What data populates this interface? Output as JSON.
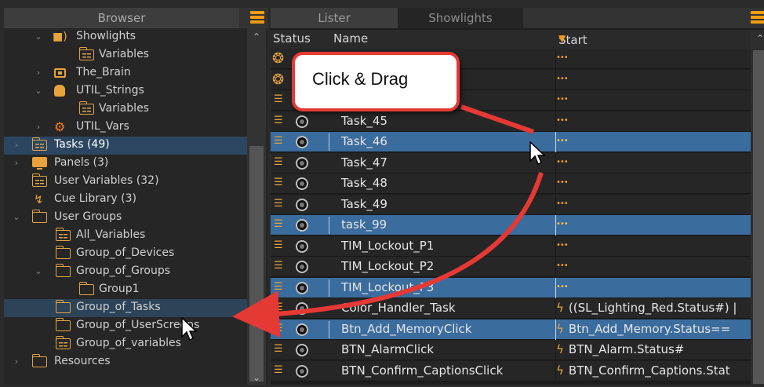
{
  "browser": {
    "tab_label": "Browser",
    "tree": [
      {
        "label": "Showlights",
        "icon": "speaker-icon",
        "expanded": true
      },
      {
        "label": "Variables",
        "icon": "variables-folder-icon"
      },
      {
        "label": "The_Brain",
        "icon": "brain-device-icon",
        "expanded": false
      },
      {
        "label": "UTIL_Strings",
        "icon": "strings-db-icon",
        "expanded": true
      },
      {
        "label": "Variables",
        "icon": "variables-folder-icon"
      },
      {
        "label": "UTIL_Vars",
        "icon": "gear-icon",
        "expanded": false
      },
      {
        "label": "Tasks (49)",
        "icon": "tasks-folder-icon",
        "expanded": false
      },
      {
        "label": "Panels (3)",
        "icon": "monitor-icon",
        "expanded": false
      },
      {
        "label": "User Variables (32)",
        "icon": "variables-folder-icon"
      },
      {
        "label": "Cue Library (3)",
        "icon": "lightning-icon"
      },
      {
        "label": "User Groups",
        "icon": "folder-icon",
        "expanded": true
      },
      {
        "label": "All_Variables",
        "icon": "variables-folder-icon"
      },
      {
        "label": "Group_of_Devices",
        "icon": "folder-icon"
      },
      {
        "label": "Group_of_Groups",
        "icon": "folder-icon",
        "expanded": true
      },
      {
        "label": "Group1",
        "icon": "folder-icon"
      },
      {
        "label": "Group_of_Tasks",
        "icon": "folder-icon"
      },
      {
        "label": "Group_of_UserScreens",
        "icon": "folder-icon"
      },
      {
        "label": "Group_of_variables",
        "icon": "variables-folder-icon"
      },
      {
        "label": "Resources",
        "icon": "folder-icon",
        "expanded": false
      }
    ]
  },
  "lister": {
    "tabs": [
      "Lister",
      "Showlights"
    ],
    "columns": {
      "status": "Status",
      "name": "Name",
      "start_condition": "Start condition"
    },
    "rows": [
      {
        "name": "",
        "condition": "•••",
        "selected": false,
        "type": "gear"
      },
      {
        "name": "",
        "condition": "•••",
        "selected": false,
        "type": "gear"
      },
      {
        "name": "",
        "condition": "•••",
        "selected": false,
        "type": "task"
      },
      {
        "name": "Task_45",
        "condition": "•••",
        "selected": false,
        "type": "task"
      },
      {
        "name": "Task_46",
        "condition": "•••",
        "selected": true,
        "type": "task"
      },
      {
        "name": "Task_47",
        "condition": "•••",
        "selected": false,
        "type": "task"
      },
      {
        "name": "Task_48",
        "condition": "•••",
        "selected": false,
        "type": "task"
      },
      {
        "name": "Task_49",
        "condition": "•••",
        "selected": false,
        "type": "task"
      },
      {
        "name": "task_99",
        "condition": "•••",
        "selected": true,
        "type": "task"
      },
      {
        "name": "TIM_Lockout_P1",
        "condition": "•••",
        "selected": false,
        "type": "task"
      },
      {
        "name": "TIM_Lockout_P2",
        "condition": "•••",
        "selected": false,
        "type": "task"
      },
      {
        "name": "TIM_Lockout_P3",
        "condition": "•••",
        "selected": true,
        "type": "task"
      },
      {
        "name": "Color_Handler_Task",
        "condition": "((SL_Lighting_Red.Status#) |",
        "selected": false,
        "type": "task",
        "trigger": true
      },
      {
        "name": "Btn_Add_MemoryClick",
        "condition": "Btn_Add_Memory.Status==",
        "selected": true,
        "type": "task",
        "trigger": true
      },
      {
        "name": "BTN_AlarmClick",
        "condition": "BTN_Alarm.Status#",
        "selected": false,
        "type": "task",
        "trigger": true
      },
      {
        "name": "BTN_Confirm_CaptionsClick",
        "condition": "BTN_Confirm_Captions.Stat",
        "selected": false,
        "type": "task",
        "trigger": true
      }
    ]
  },
  "callout": {
    "text": "Click & Drag"
  },
  "colors": {
    "accent": "#f39c12",
    "selection": "#3a6c9d",
    "arrow": "#e53935"
  }
}
